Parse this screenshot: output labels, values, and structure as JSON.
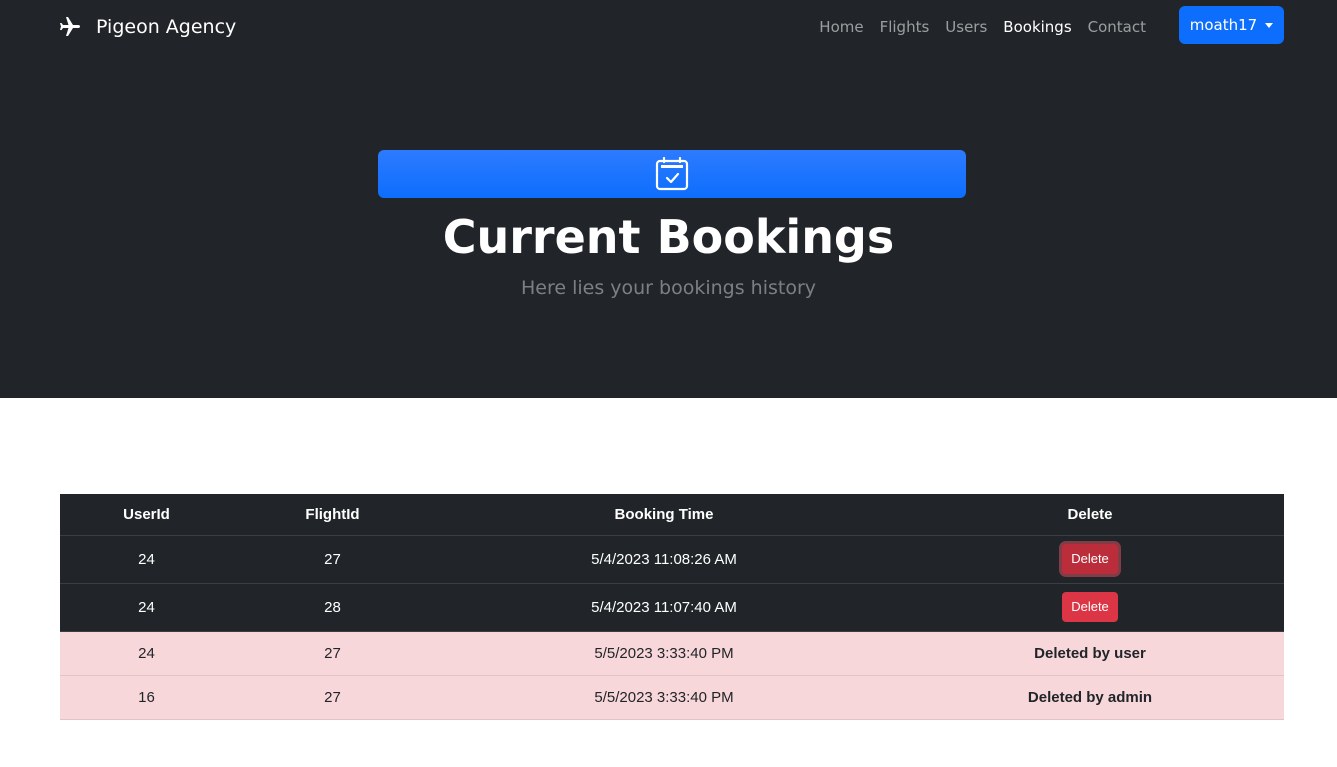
{
  "brand": {
    "name": "Pigeon Agency",
    "icon": "airplane-icon"
  },
  "nav": {
    "items": [
      {
        "label": "Home",
        "active": false
      },
      {
        "label": "Flights",
        "active": false
      },
      {
        "label": "Users",
        "active": false
      },
      {
        "label": "Bookings",
        "active": true
      },
      {
        "label": "Contact",
        "active": false
      }
    ],
    "user_menu_label": "moath17"
  },
  "hero": {
    "icon": "calendar-check-icon",
    "title": "Current Bookings",
    "subtitle": "Here lies your bookings history"
  },
  "table": {
    "headers": [
      "UserId",
      "FlightId",
      "Booking Time",
      "Delete"
    ],
    "rows": [
      {
        "user_id": "24",
        "flight_id": "27",
        "booking_time": "5/4/2023 11:08:26 AM",
        "action": "Delete",
        "deleted": false
      },
      {
        "user_id": "24",
        "flight_id": "28",
        "booking_time": "5/4/2023 11:07:40 AM",
        "action": "Delete",
        "deleted": false
      },
      {
        "user_id": "24",
        "flight_id": "27",
        "booking_time": "5/5/2023 3:33:40 PM",
        "action": "Deleted by user",
        "deleted": true
      },
      {
        "user_id": "16",
        "flight_id": "27",
        "booking_time": "5/5/2023 3:33:40 PM",
        "action": "Deleted by admin",
        "deleted": true
      }
    ]
  },
  "colors": {
    "dark": "#212529",
    "primary": "#0d6efd",
    "danger": "#dc3545",
    "deleted_row": "#f8d7da"
  }
}
